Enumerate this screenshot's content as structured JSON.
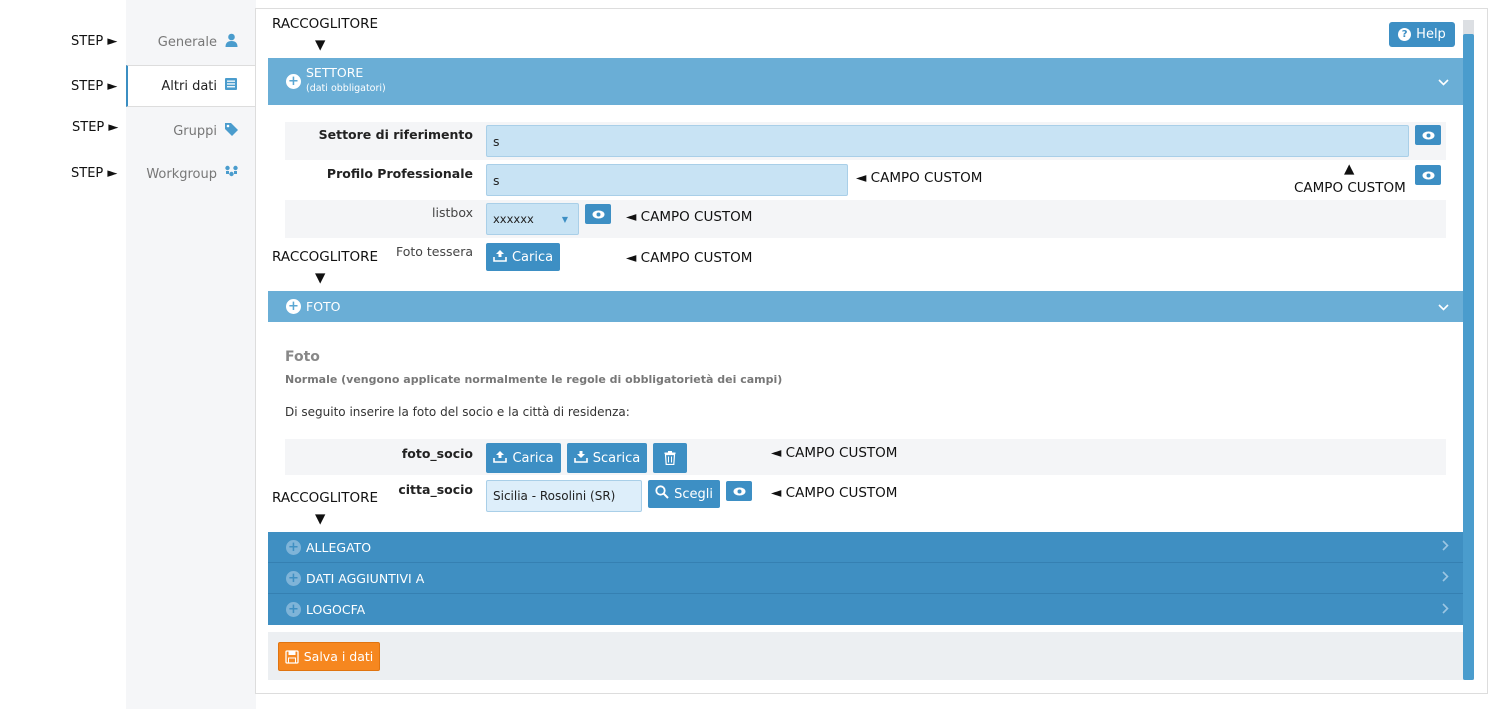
{
  "annotations": {
    "step": "STEP ►",
    "raccoglitore": "RACCOGLITORE",
    "arrow_down": "▼",
    "arrow_up": "▲",
    "campo_custom_left": "◄ CAMPO CUSTOM",
    "campo_custom": "CAMPO CUSTOM"
  },
  "nav": {
    "tabs": [
      {
        "label": "Generale",
        "icon": "user-icon"
      },
      {
        "label": "Altri dati",
        "icon": "form-icon"
      },
      {
        "label": "Gruppi",
        "icon": "tag-icon"
      },
      {
        "label": "Workgroup",
        "icon": "workgroup-icon"
      }
    ]
  },
  "help_label": "Help",
  "sections": {
    "settore": {
      "title": "SETTORE",
      "subtitle": "(dati obbligatori)"
    },
    "foto": {
      "title": "FOTO"
    },
    "allegato": {
      "title": "ALLEGATO"
    },
    "dati_aggiuntivi": {
      "title": "DATI AGGIUNTIVI A"
    },
    "logocfa": {
      "title": "LOGOCFA"
    }
  },
  "fields": {
    "settore_label": "Settore di riferimento",
    "settore_value": "s",
    "profilo_label": "Profilo Professionale",
    "profilo_value": "s",
    "listbox_label": "listbox",
    "listbox_value": "xxxxxx",
    "foto_tessera_label": "Foto tessera",
    "carica": "Carica",
    "scarica": "Scarica",
    "foto_socio_label": "foto_socio",
    "citta_socio_label": "citta_socio",
    "citta_socio_value": "Sicilia - Rosolini (SR)",
    "scegli": "Scegli"
  },
  "foto_block": {
    "heading": "Foto",
    "note": "Normale (vengono applicate normalmente le regole di obbligatorietà dei campi)",
    "instruction": "Di seguito inserire la foto del socio e la città di residenza:"
  },
  "save_label": "Salva i dati",
  "colors": {
    "accent": "#3d8fc4",
    "section_light": "#6aaed6",
    "save": "#f6871f"
  }
}
